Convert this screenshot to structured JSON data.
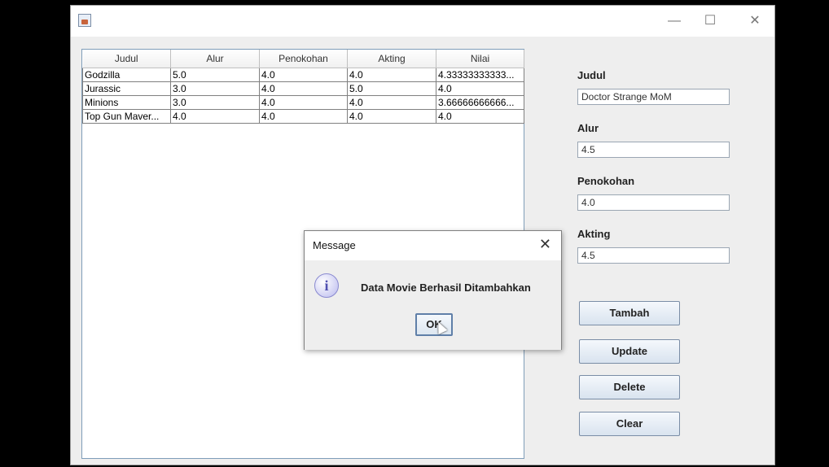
{
  "window": {
    "controls": {
      "minimize": "—",
      "maximize": "☐",
      "close": "✕"
    }
  },
  "table": {
    "columns": [
      "Judul",
      "Alur",
      "Penokohan",
      "Akting",
      "Nilai"
    ],
    "rows": [
      [
        "Godzilla",
        "5.0",
        "4.0",
        "4.0",
        "4.33333333333..."
      ],
      [
        "Jurassic",
        "3.0",
        "4.0",
        "5.0",
        "4.0"
      ],
      [
        "Minions",
        "3.0",
        "4.0",
        "4.0",
        "3.66666666666..."
      ],
      [
        "Top Gun Maver...",
        "4.0",
        "4.0",
        "4.0",
        "4.0"
      ]
    ]
  },
  "form": {
    "judul_label": "Judul",
    "judul_value": "Doctor Strange MoM",
    "alur_label": "Alur",
    "alur_value": "4.5",
    "penokohan_label": "Penokohan",
    "penokohan_value": "4.0",
    "akting_label": "Akting",
    "akting_value": "4.5"
  },
  "buttons": {
    "tambah": "Tambah",
    "update": "Update",
    "delete": "Delete",
    "clear": "Clear"
  },
  "dialog": {
    "title": "Message",
    "close": "✕",
    "icon": "i",
    "message": "Data Movie Berhasil Ditambahkan",
    "ok": "OK"
  }
}
